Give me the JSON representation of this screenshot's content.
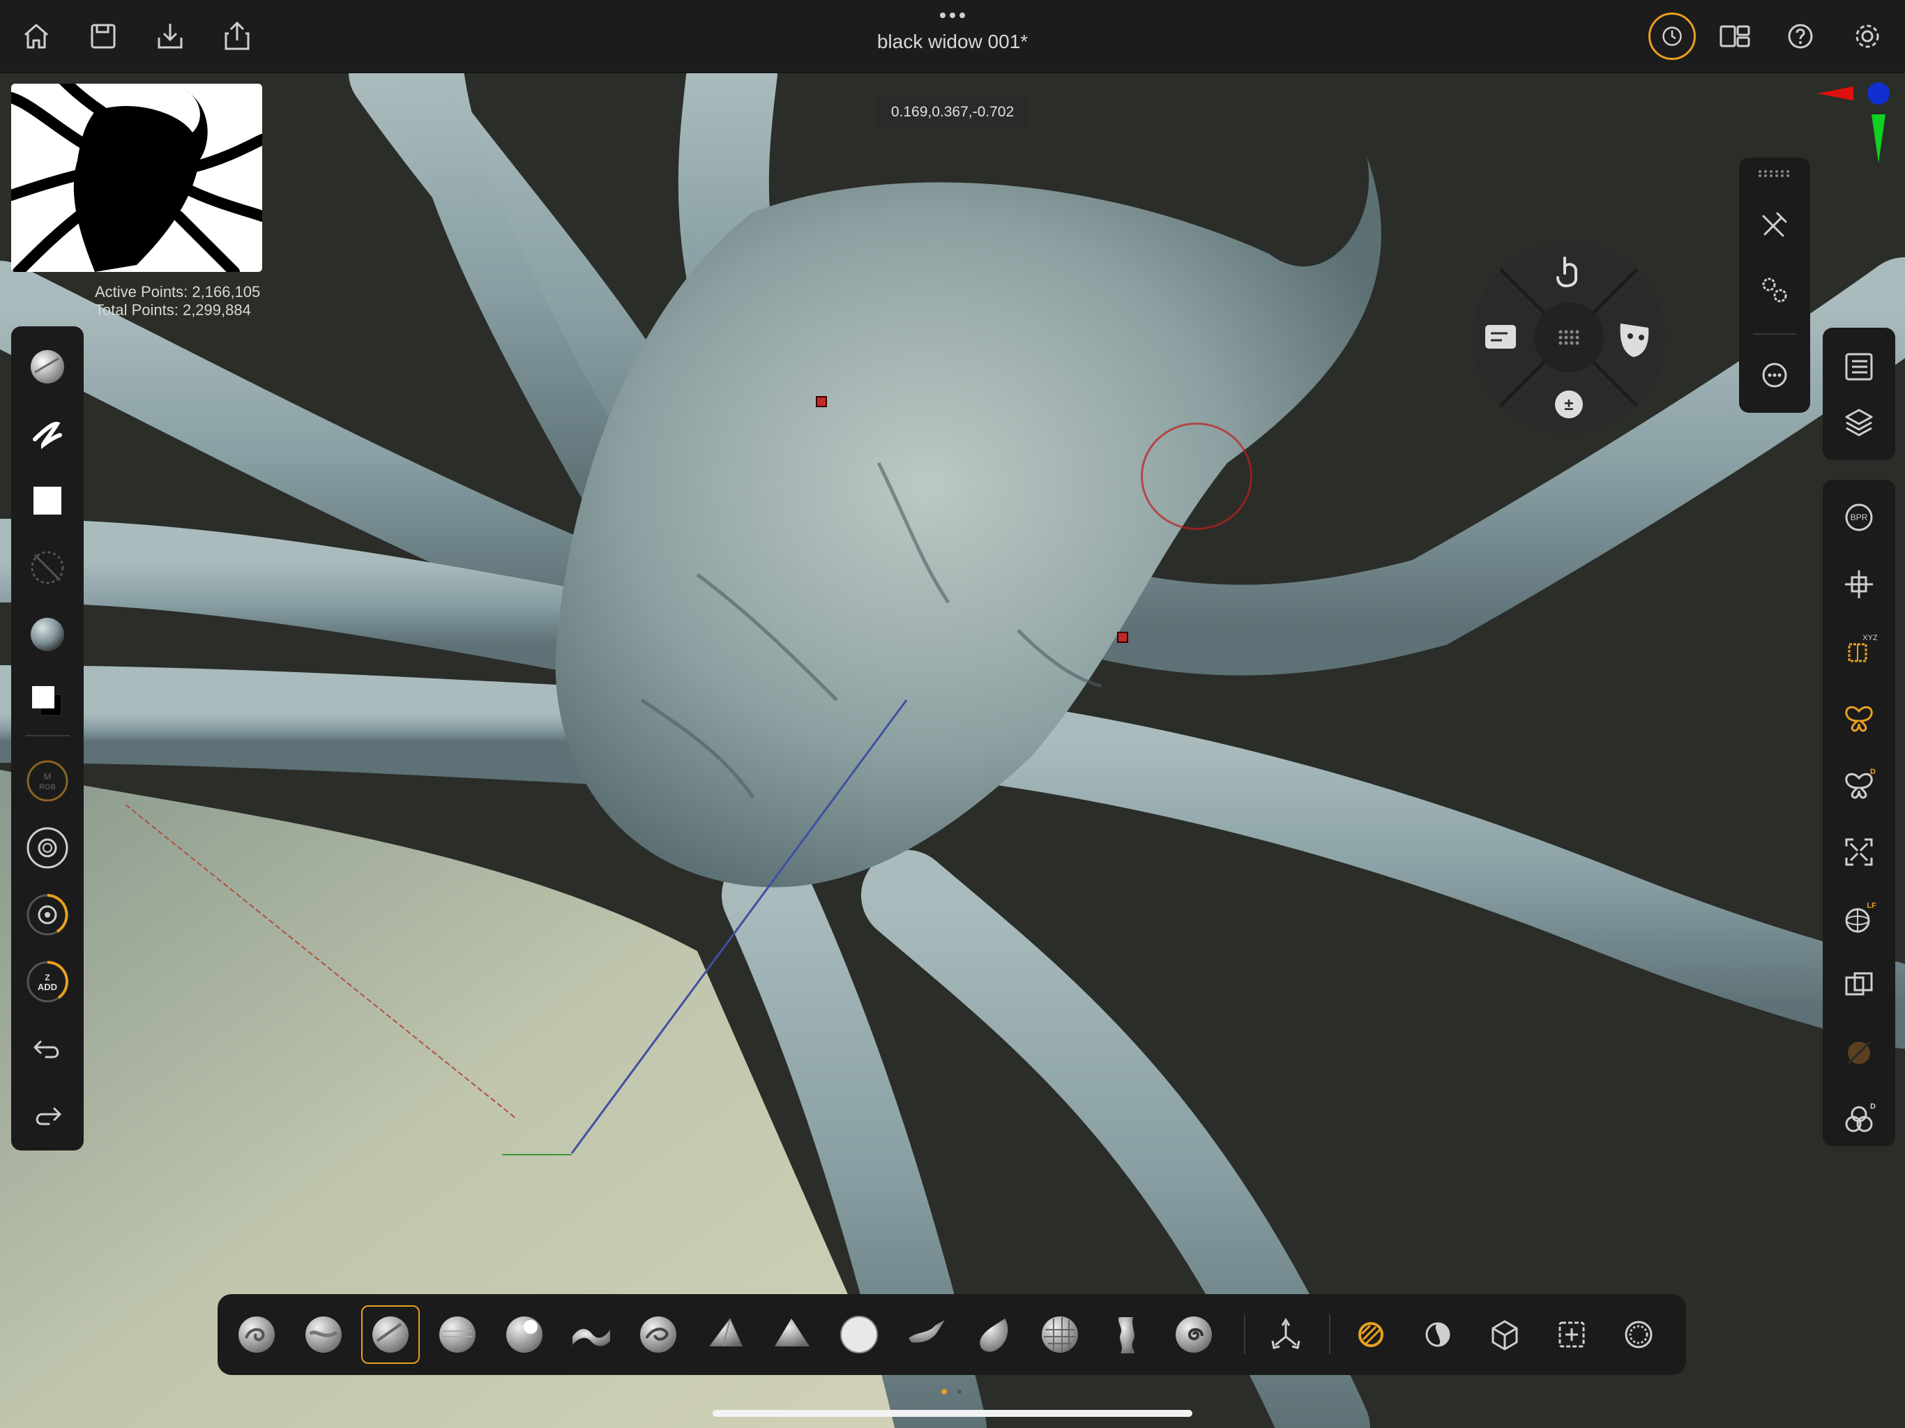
{
  "topbar": {
    "title": "black widow 001*",
    "left_icons": [
      "home-icon",
      "save-icon",
      "import-icon",
      "share-icon"
    ],
    "right_icons": [
      "history-icon",
      "layout-icon",
      "help-icon",
      "settings-icon"
    ]
  },
  "viewport": {
    "coordinates": "0.169,0.367,-0.702",
    "active_points": "Active Points: 2,166,105",
    "total_points": "Total Points: 2,299,884"
  },
  "left_toolbar": {
    "items": [
      "brush-material-icon",
      "stroke-icon",
      "alpha-icon",
      "texture-disabled-icon",
      "material-icon",
      "color-swatch-icon",
      "mrgb-icon",
      "draw-size-icon",
      "focal-shift-icon",
      "z-add-icon",
      "undo-icon",
      "redo-icon"
    ],
    "mrgb_label": "M\nRGB",
    "zadd_label_top": "Z",
    "zadd_label_bottom": "ADD"
  },
  "right_toolbar": {
    "top_items": [
      "subtool-list-icon",
      "layers-icon"
    ],
    "items": [
      "bpr-icon",
      "transform-icon",
      "xyz-icon",
      "symmetry-icon",
      "dynamic-icon",
      "frame-icon",
      "local-icon",
      "transp-icon",
      "solo-icon",
      "polyframe-icon"
    ],
    "bpr_label": "BPR",
    "xyz_badge": "XYZ",
    "dynamic_badge": "D",
    "local_badge": "LF",
    "poly_badge": "D"
  },
  "float_panel": {
    "items": [
      "tools-icon",
      "gear-settings-icon",
      "more-icon"
    ]
  },
  "gesture_wheel": {
    "items": [
      "touch-icon",
      "menu-icon",
      "mask-icon",
      "add-sub-icon",
      "grid-icon"
    ]
  },
  "bottom_toolbar": {
    "brushes": [
      "clay-buildup-brush",
      "clay-brush",
      "standard-brush",
      "smooth-brush",
      "inflate-brush",
      "move-brush",
      "dam-standard-brush",
      "trim-brush",
      "hpolish-brush",
      "sphere-brush",
      "snakehook-brush",
      "pinch-brush",
      "mask-brush",
      "slice-brush",
      "spiral-brush"
    ],
    "selected_index": 2,
    "tools": [
      "gizmo-icon",
      "draw-mode-icon",
      "contrast-icon",
      "cube-icon",
      "select-icon",
      "blend-icon"
    ]
  },
  "colors": {
    "accent": "#e8a020",
    "bg_dark": "#1b1b1b",
    "mesh": "#8fa2a5",
    "background": "#2b2d28"
  }
}
